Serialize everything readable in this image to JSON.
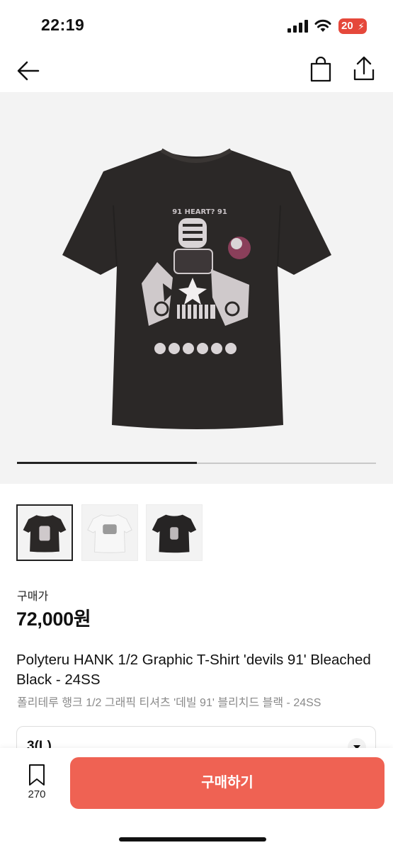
{
  "status_bar": {
    "time": "22:19",
    "battery": "20"
  },
  "product": {
    "price_label": "구매가",
    "price": "72,000원",
    "title": "Polyteru HANK 1/2 Graphic T-Shirt 'devils 91' Bleached Black - 24SS",
    "subtitle": "폴리테루 행크 1/2 그래픽 티셔츠 '데빌 91' 블리치드 블랙 - 24SS",
    "print_text": "91 HEART? 91",
    "gallery_progress": 0.5
  },
  "thumbnails": [
    {
      "variant": "black",
      "selected": true
    },
    {
      "variant": "white",
      "selected": false
    },
    {
      "variant": "black-alt",
      "selected": false
    }
  ],
  "size_select": {
    "value": "3(L)"
  },
  "bottom_bar": {
    "bookmark_count": "270",
    "buy_label": "구매하기"
  },
  "colors": {
    "accent": "#ef6253",
    "battery": "#e5483b",
    "shirt": "#2b2827"
  },
  "icons": [
    "back-arrow-icon",
    "shopping-bag-icon",
    "share-icon",
    "bookmark-icon",
    "chevron-down-icon",
    "signal-icon",
    "wifi-icon",
    "battery-icon"
  ]
}
